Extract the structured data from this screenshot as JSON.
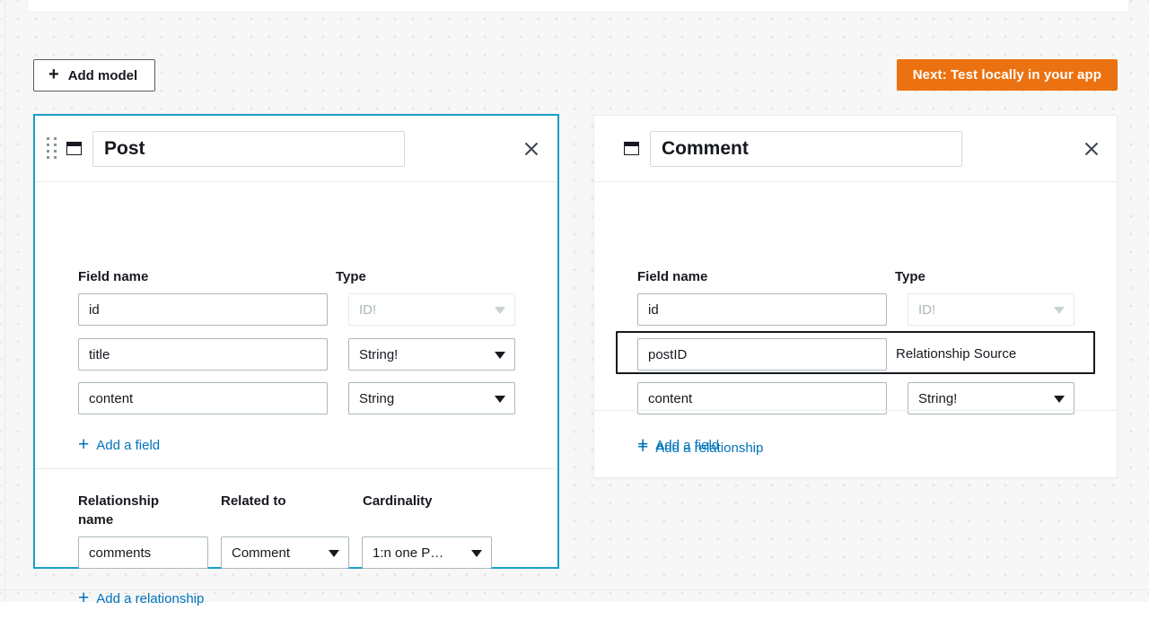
{
  "toolbar": {
    "add_model_label": "Add model",
    "add_model_icon": "plus-icon",
    "next_button_label": "Next: Test locally in your app",
    "next_button_color": "#ec7211"
  },
  "models": [
    {
      "name": "Post",
      "selected": true,
      "selected_border_color": "#1a9fc4",
      "has_drag_handle": true,
      "close_icon": "close-icon",
      "model_icon": "model-table-icon",
      "fields_section": {
        "col_field_name": "Field name",
        "col_type": "Type",
        "fields": [
          {
            "name": "id",
            "type": "ID!",
            "type_disabled": true
          },
          {
            "name": "title",
            "type": "String!",
            "type_disabled": false
          },
          {
            "name": "content",
            "type": "String",
            "type_disabled": false
          }
        ],
        "add_field_label": "Add a field"
      },
      "relationships_section": {
        "col_relationship_name": "Relationship name",
        "col_related_to": "Related to",
        "col_cardinality": "Cardinality",
        "relationships": [
          {
            "name": "comments",
            "related_to": "Comment",
            "cardinality": "1:n one P…"
          }
        ],
        "add_relationship_label": "Add a relationship"
      }
    },
    {
      "name": "Comment",
      "selected": false,
      "has_drag_handle": false,
      "close_icon": "close-icon",
      "model_icon": "model-table-icon",
      "fields_section": {
        "col_field_name": "Field name",
        "col_type": "Type",
        "fields": [
          {
            "name": "id",
            "type": "ID!",
            "type_disabled": true
          },
          {
            "name": "postID",
            "type": "Relationship Source",
            "is_relationship_source": true,
            "highlighted": true
          },
          {
            "name": "content",
            "type": "String!",
            "type_disabled": false
          }
        ],
        "add_field_label": "Add a field"
      },
      "relationships_section": {
        "add_relationship_label": "Add a relationship"
      }
    }
  ]
}
